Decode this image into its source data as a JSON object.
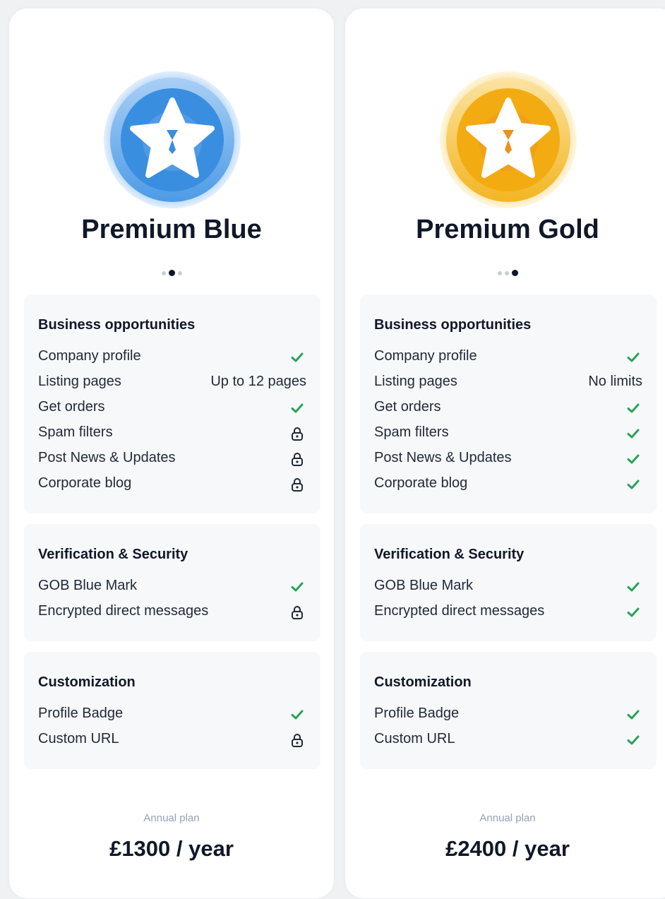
{
  "plans": [
    {
      "name": "Premium Blue",
      "accent": "#3a8ee0",
      "pager": {
        "total": 3,
        "active": 1
      },
      "sections": [
        {
          "title": "Business opportunities",
          "rows": [
            {
              "label": "Company profile",
              "type": "check"
            },
            {
              "label": "Listing pages",
              "type": "text",
              "value": "Up to 12 pages"
            },
            {
              "label": "Get orders",
              "type": "check"
            },
            {
              "label": "Spam filters",
              "type": "lock"
            },
            {
              "label": "Post News & Updates",
              "type": "lock"
            },
            {
              "label": "Corporate blog",
              "type": "lock"
            }
          ]
        },
        {
          "title": "Verification & Security",
          "rows": [
            {
              "label": "GOB Blue Mark",
              "type": "check"
            },
            {
              "label": "Encrypted direct messages",
              "type": "lock"
            }
          ]
        },
        {
          "title": "Customization",
          "rows": [
            {
              "label": "Profile Badge",
              "type": "check"
            },
            {
              "label": "Custom URL",
              "type": "lock"
            }
          ]
        }
      ],
      "annual_label": "Annual plan",
      "price": "£1300 / year"
    },
    {
      "name": "Premium Gold",
      "accent": "#f2b01e",
      "pager": {
        "total": 3,
        "active": 2
      },
      "sections": [
        {
          "title": "Business opportunities",
          "rows": [
            {
              "label": "Company profile",
              "type": "check"
            },
            {
              "label": "Listing pages",
              "type": "text",
              "value": "No limits"
            },
            {
              "label": "Get orders",
              "type": "check"
            },
            {
              "label": "Spam filters",
              "type": "check"
            },
            {
              "label": "Post News & Updates",
              "type": "check"
            },
            {
              "label": "Corporate blog",
              "type": "check"
            }
          ]
        },
        {
          "title": "Verification & Security",
          "rows": [
            {
              "label": "GOB Blue Mark",
              "type": "check"
            },
            {
              "label": "Encrypted direct messages",
              "type": "check"
            }
          ]
        },
        {
          "title": "Customization",
          "rows": [
            {
              "label": "Profile Badge",
              "type": "check"
            },
            {
              "label": "Custom URL",
              "type": "check"
            }
          ]
        }
      ],
      "annual_label": "Annual plan",
      "price": "£2400 / year"
    }
  ],
  "colors": {
    "check": "#27a35a",
    "lock": "#1f2937"
  }
}
